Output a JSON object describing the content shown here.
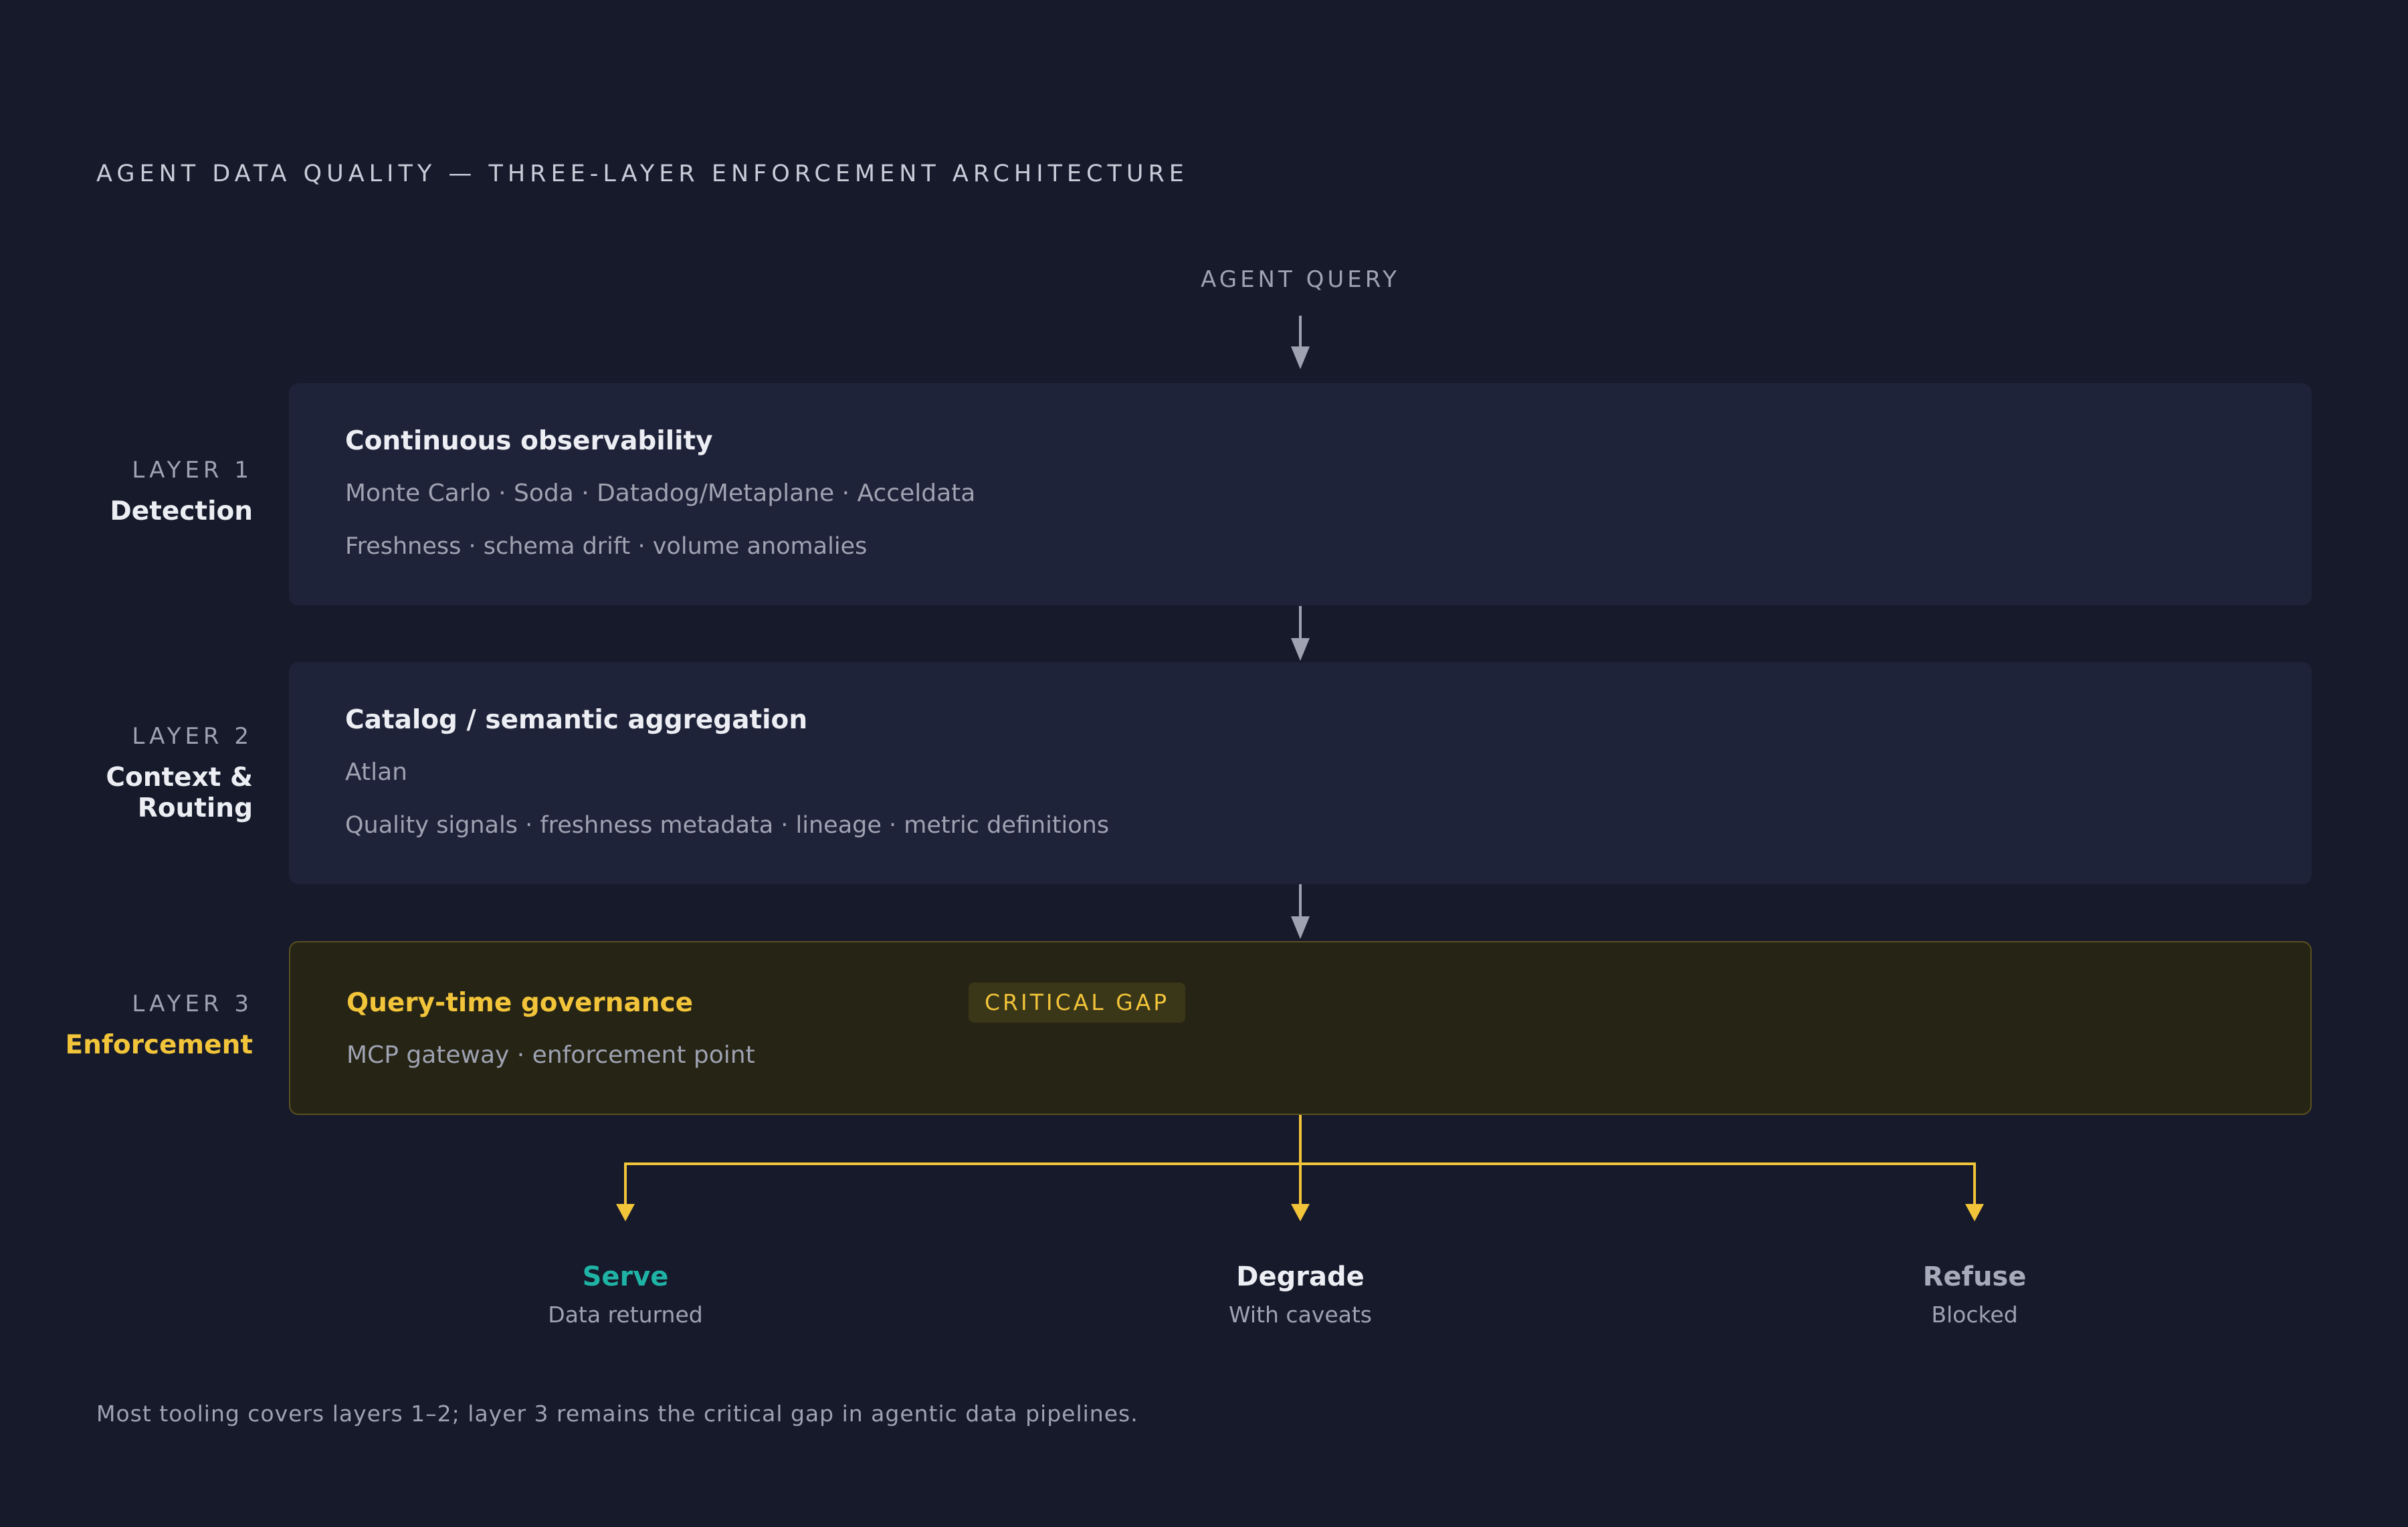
{
  "title": "AGENT DATA QUALITY — THREE-LAYER ENFORCEMENT ARCHITECTURE",
  "entry": {
    "label": "AGENT QUERY"
  },
  "layers": [
    {
      "number": "LAYER 1",
      "name": "Detection",
      "heading": "Continuous observability",
      "tools": "Monte Carlo · Soda · Datadog/Metaplane · Acceldata",
      "signals": "Freshness · schema drift · volume anomalies"
    },
    {
      "number": "LAYER 2",
      "name": "Context & Routing",
      "heading": "Catalog / semantic aggregation",
      "tools": "Atlan",
      "signals": "Quality signals · freshness metadata · lineage · metric definitions"
    },
    {
      "number": "LAYER 3",
      "name": "Enforcement",
      "heading": "Query-time governance",
      "badge": "CRITICAL GAP",
      "tools": "MCP gateway · enforcement point"
    }
  ],
  "outcomes": [
    {
      "name": "Serve",
      "sub": "Data returned",
      "color": "#1fb3a5"
    },
    {
      "name": "Degrade",
      "sub": "With caveats",
      "color": "#eceef4"
    },
    {
      "name": "Refuse",
      "sub": "Blocked",
      "color": "#a7aab8"
    }
  ],
  "footer": "Most tooling covers layers 1–2; layer 3 remains the critical gap in agentic data pipelines.",
  "colors": {
    "background": "#161a2a",
    "panel": "#1f2339",
    "accent": "#f2c43a",
    "arrow": "#9ea2b1"
  }
}
